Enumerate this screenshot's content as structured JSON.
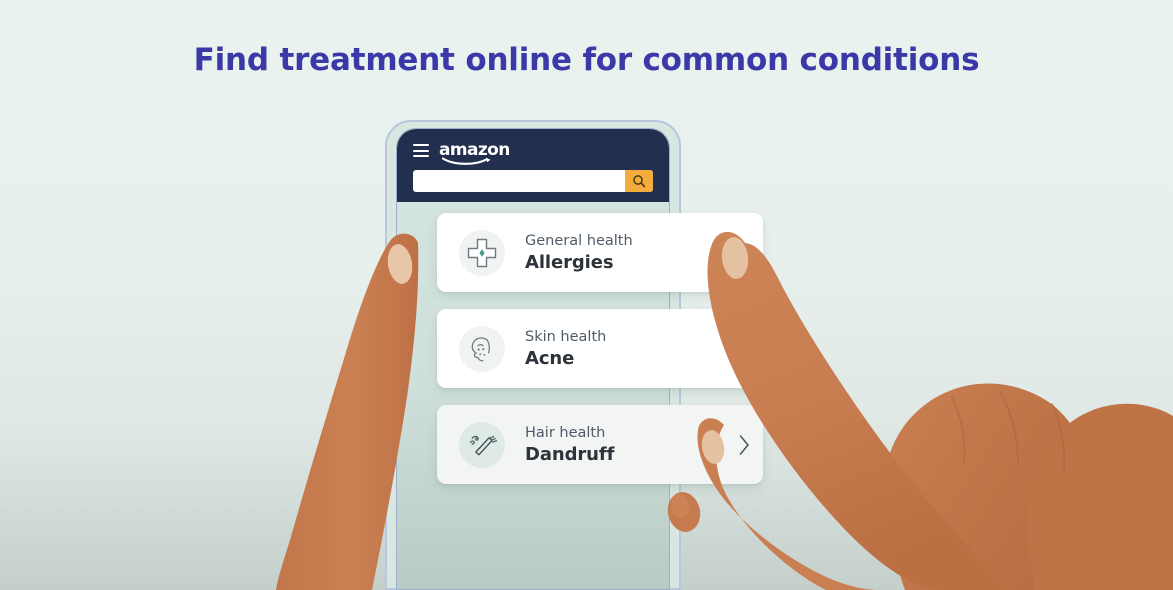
{
  "headline": "Find treatment online for common conditions",
  "colors": {
    "headline": "#3b38a8",
    "background_top": "#eaf2ef",
    "background_bottom": "#c4cfcb",
    "nav_bar": "#232f4e",
    "search_button": "#f4ac3c",
    "phone_frame": "#b9c6de",
    "skin": "#c87e50",
    "nail": "#e6c3a3",
    "icon_accent": "#3f9e86",
    "card_text": "#2d3339",
    "card_kicker": "#4f5b66"
  },
  "phone": {
    "nav": {
      "menu_icon": "hamburger-menu-icon",
      "brand": "amazon",
      "brand_smile_icon": "amazon-smile-icon"
    },
    "search": {
      "value": "",
      "placeholder": "",
      "button_icon": "search-icon"
    }
  },
  "cards": [
    {
      "kicker": "General health",
      "title": "Allergies",
      "icon": "medical-cross-icon",
      "has_chevron": false,
      "state": "highlighted"
    },
    {
      "kicker": "Skin health",
      "title": "Acne",
      "icon": "face-acne-icon",
      "has_chevron": true,
      "chevron_icon": "chevron-right-icon",
      "state": "default"
    },
    {
      "kicker": "Hair health",
      "title": "Dandruff",
      "icon": "comb-dandruff-icon",
      "has_chevron": true,
      "chevron_icon": "chevron-right-icon",
      "state": "dimmed"
    }
  ],
  "illustration": {
    "left_hand": "left-thumb-holding-phone",
    "right_hand": "right-hand-index-finger-tapping"
  }
}
